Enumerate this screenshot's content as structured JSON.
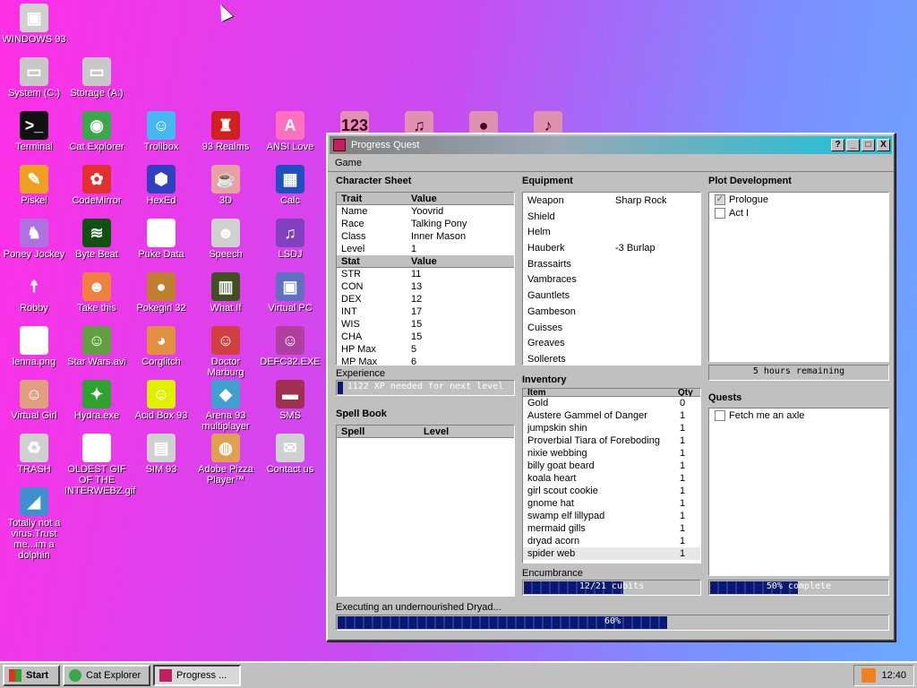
{
  "desktop": {
    "icons": [
      {
        "label": "WINDOWS 93",
        "glyph": "▣",
        "bg": "#d0d0d0"
      },
      {
        "label": "System (C:)",
        "glyph": "▭",
        "bg": "#c8c8c8"
      },
      {
        "label": "Storage (A:)",
        "glyph": "▭",
        "bg": "#c8c8c8"
      },
      {
        "label": "Terminal",
        "glyph": ">_",
        "bg": "#111111"
      },
      {
        "label": "Cat Explorer",
        "glyph": "◉",
        "bg": "#3aa84a"
      },
      {
        "label": "Trollbox",
        "glyph": "☺",
        "bg": "#46b8f0"
      },
      {
        "label": "93 Realms",
        "glyph": "♜",
        "bg": "#d02020"
      },
      {
        "label": "ANSI Love",
        "glyph": "A",
        "bg": "#ff70c0"
      },
      {
        "label": "Piskel",
        "glyph": "✎",
        "bg": "#f0a020"
      },
      {
        "label": "CodeMirror",
        "glyph": "✿",
        "bg": "#e03030"
      },
      {
        "label": "HexEd",
        "glyph": "⬢",
        "bg": "#3040c0"
      },
      {
        "label": "3D",
        "glyph": "☕",
        "bg": "#e8a0a0"
      },
      {
        "label": "Calc",
        "glyph": "▦",
        "bg": "#2050c0"
      },
      {
        "label": "Poney Jockey",
        "glyph": "♞",
        "bg": "#b070e0"
      },
      {
        "label": "Byte Beat",
        "glyph": "≋",
        "bg": "#105010"
      },
      {
        "label": "Puke Data",
        "glyph": "Pd",
        "bg": "#ffffff"
      },
      {
        "label": "Speech",
        "glyph": "☻",
        "bg": "#d0d0d0"
      },
      {
        "label": "LSDJ",
        "glyph": "♫",
        "bg": "#8040c0"
      },
      {
        "label": "Robby",
        "glyph": "☨",
        "bg": "transparent"
      },
      {
        "label": "Take this",
        "glyph": "☻",
        "bg": "#f08040"
      },
      {
        "label": "Pokegirl 32",
        "glyph": "●",
        "bg": "#c08030"
      },
      {
        "label": "What If",
        "glyph": "▥",
        "bg": "#405020"
      },
      {
        "label": "Virtual PC",
        "glyph": "▣",
        "bg": "#6070c0"
      },
      {
        "label": "lenna.png",
        "glyph": "✦",
        "bg": "#ffffff"
      },
      {
        "label": "Star Wars.avi",
        "glyph": "☺",
        "bg": "#60a040"
      },
      {
        "label": "Corglitch",
        "glyph": "◕",
        "bg": "#e09040"
      },
      {
        "label": "Doctor Marburg",
        "glyph": "☺",
        "bg": "#d04040"
      },
      {
        "label": "DEFC32.EXE",
        "glyph": "☺",
        "bg": "#b040a0"
      },
      {
        "label": "Virtual Girl",
        "glyph": "☺",
        "bg": "#e0a080"
      },
      {
        "label": "Hydra.exe",
        "glyph": "✦",
        "bg": "#30a030"
      },
      {
        "label": "Acid Box 93",
        "glyph": "☺",
        "bg": "#e0f000"
      },
      {
        "label": "Arena 93 multiplayer",
        "glyph": "◆",
        "bg": "#40a0d0"
      },
      {
        "label": "SMS",
        "glyph": "▬",
        "bg": "#a03050"
      },
      {
        "label": "TRASH",
        "glyph": "♻",
        "bg": "#d0d0d0"
      },
      {
        "label": "OLDEST GIF OF THE INTERWEBZ.gif",
        "glyph": "✦",
        "bg": "#ffffff"
      },
      {
        "label": "SIM 93",
        "glyph": "▤",
        "bg": "#d0d0d0"
      },
      {
        "label": "Adobe Pizza Player™",
        "glyph": "◍",
        "bg": "#e0a050"
      },
      {
        "label": "Contact us",
        "glyph": "✉",
        "bg": "#d0d0d0"
      },
      {
        "label": "Totally not a virus.Trust me...im a dolphin",
        "glyph": "◢",
        "bg": "#4090d0"
      }
    ],
    "top_icons": [
      {
        "glyph": "123"
      },
      {
        "glyph": "♫"
      },
      {
        "glyph": "●"
      },
      {
        "glyph": "♪"
      }
    ]
  },
  "window": {
    "title": "Progress Quest",
    "buttons": {
      "help": "?",
      "minimize": "_",
      "maximize": "□",
      "close": "X"
    },
    "menu": "Game",
    "character": {
      "heading": "Character Sheet",
      "trait_header": [
        "Trait",
        "Value"
      ],
      "traits": [
        {
          "k": "Name",
          "v": "Yoovrid"
        },
        {
          "k": "Race",
          "v": "Talking Pony"
        },
        {
          "k": "Class",
          "v": "Inner Mason"
        },
        {
          "k": "Level",
          "v": "1"
        }
      ],
      "stat_header": [
        "Stat",
        "Value"
      ],
      "stats": [
        {
          "k": "STR",
          "v": "11"
        },
        {
          "k": "CON",
          "v": "13"
        },
        {
          "k": "DEX",
          "v": "12"
        },
        {
          "k": "INT",
          "v": "17"
        },
        {
          "k": "WIS",
          "v": "15"
        },
        {
          "k": "CHA",
          "v": "15"
        },
        {
          "k": "HP Max",
          "v": "5"
        },
        {
          "k": "MP Max",
          "v": "6"
        }
      ]
    },
    "experience": {
      "label": "Experience",
      "text": "1122 XP needed for next level",
      "fraction": 0.02
    },
    "spellbook": {
      "heading": "Spell Book",
      "header": [
        "Spell",
        "Level"
      ]
    },
    "equipment": {
      "heading": "Equipment",
      "items": [
        {
          "k": "Weapon",
          "v": "Sharp Rock"
        },
        {
          "k": "Shield",
          "v": ""
        },
        {
          "k": "Helm",
          "v": ""
        },
        {
          "k": "Hauberk",
          "v": "-3 Burlap"
        },
        {
          "k": "Brassairts",
          "v": ""
        },
        {
          "k": "Vambraces",
          "v": ""
        },
        {
          "k": "Gauntlets",
          "v": ""
        },
        {
          "k": "Gambeson",
          "v": ""
        },
        {
          "k": "Cuisses",
          "v": ""
        },
        {
          "k": "Greaves",
          "v": ""
        },
        {
          "k": "Sollerets",
          "v": ""
        }
      ]
    },
    "inventory": {
      "heading": "Inventory",
      "header": [
        "Item",
        "Qty"
      ],
      "items": [
        {
          "k": "Gold",
          "v": "0"
        },
        {
          "k": "Austere Gammel of Danger",
          "v": "1"
        },
        {
          "k": "jumpskin shin",
          "v": "1"
        },
        {
          "k": "Proverbial Tiara of Foreboding",
          "v": "1"
        },
        {
          "k": "nixie webbing",
          "v": "1"
        },
        {
          "k": "billy goat beard",
          "v": "1"
        },
        {
          "k": "koala heart",
          "v": "1"
        },
        {
          "k": "girl scout cookie",
          "v": "1"
        },
        {
          "k": "gnome hat",
          "v": "1"
        },
        {
          "k": "swamp elf lillypad",
          "v": "1"
        },
        {
          "k": "mermaid gills",
          "v": "1"
        },
        {
          "k": "dryad acorn",
          "v": "1"
        },
        {
          "k": "spider web",
          "v": "1"
        }
      ]
    },
    "encumbrance": {
      "label": "Encumbrance",
      "text": "12/21 cubits",
      "fraction": 0.571
    },
    "plot": {
      "heading": "Plot Development",
      "items": [
        {
          "label": "Prologue",
          "checked": true
        },
        {
          "label": "Act I",
          "checked": false
        }
      ],
      "bar_text": "5 hours remaining",
      "fraction": 0.0
    },
    "quests": {
      "heading": "Quests",
      "items": [
        {
          "label": "Fetch me an axle",
          "checked": false
        }
      ],
      "bar_text": "50% complete",
      "fraction": 0.5
    },
    "task": {
      "text": "Executing an undernourished Dryad...",
      "bar_text": "60%",
      "fraction": 0.6
    }
  },
  "taskbar": {
    "start": "Start",
    "tasks": [
      {
        "label": "Cat Explorer"
      },
      {
        "label": "Progress ..."
      }
    ],
    "clock": "12:40"
  }
}
